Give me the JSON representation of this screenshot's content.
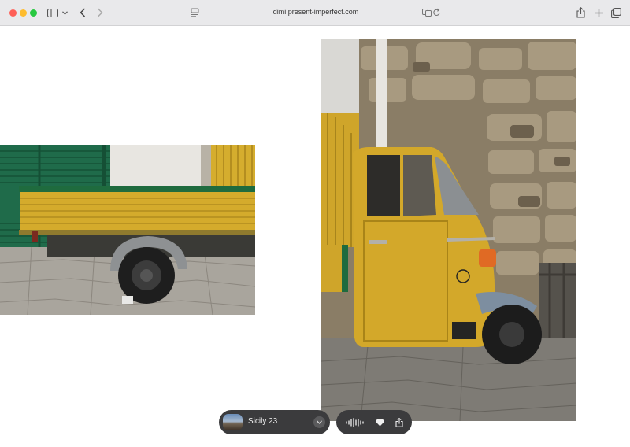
{
  "browser": {
    "url": "dimi.present-imperfect.com",
    "icons": {
      "sidebar": "sidebar-icon",
      "back": "chevron-left-icon",
      "forward": "chevron-right-icon",
      "translate": "translate-icon",
      "reload": "reload-icon",
      "share": "share-icon",
      "new_tab": "plus-icon",
      "tabs": "tab-overview-icon"
    }
  },
  "gallery": {
    "photos": [
      {
        "subject": "yellow-truck-bed"
      },
      {
        "subject": "yellow-three-wheeler"
      }
    ]
  },
  "album": {
    "title": "Sicily 23"
  },
  "actions": {
    "icons": [
      "waveform-icon",
      "heart-icon",
      "share-icon"
    ]
  },
  "colors": {
    "chrome": "#e9e9eb",
    "pill": "#3b3b3d",
    "vehicle_yellow": "#d8b22e"
  }
}
